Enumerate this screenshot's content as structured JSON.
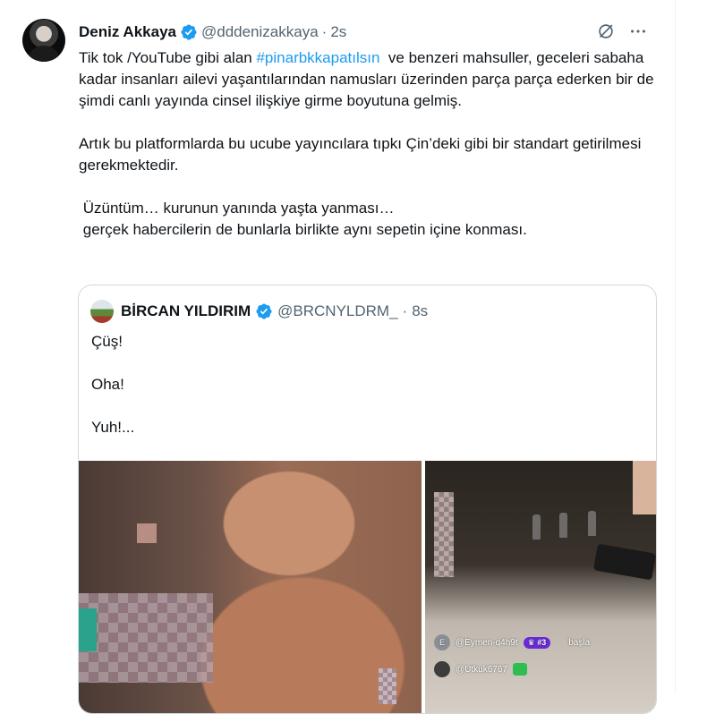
{
  "tweet": {
    "author": {
      "name": "Deniz Akkaya",
      "handle": "@dddenizakkaya",
      "separator": "·",
      "time": "2s"
    },
    "text": {
      "p1_before": "Tik tok /YouTube gibi alan ",
      "hashtag": "#pinarbkkapatılsın",
      "p1_after": "  ve benzeri mahsuller, geceleri sabaha kadar insanları ailevi yaşantılarından namusları üzerinden parça parça ederken bir de şimdi canlı yayında cinsel ilişkiye girme boyutuna gelmiş.",
      "p2": "Artık bu platformlarda bu ucube yayıncılara tıpkı Çin’deki gibi bir standart getirilmesi gerekmektedir.",
      "p3": " Üzüntüm… kurunun yanında yaşta yanması…\n gerçek habercilerin de bunlarla birlikte aynı sepetin içine konması."
    }
  },
  "quote": {
    "author": {
      "name": "BİRCAN YILDIRIM",
      "handle": "@BRCNYLDRM_",
      "separator": "·",
      "time": "8s"
    },
    "lines": [
      "Çüş!",
      "Oha!",
      "Yuh!..."
    ],
    "live_comments": [
      {
        "avatar_letter": "E",
        "user": "@Eymen-q4h9t",
        "badge": "#3",
        "extra": "başla"
      },
      {
        "avatar_letter": "",
        "user": "@Utkuk6767",
        "badge": "",
        "extra": ""
      }
    ]
  },
  "colors": {
    "link": "#1d9bf0",
    "verified": "#1d9bf0",
    "secondary_text": "#536471",
    "border": "#cfd9de"
  },
  "icons": [
    "verified-badge-icon",
    "grok-icon",
    "more-icon"
  ]
}
